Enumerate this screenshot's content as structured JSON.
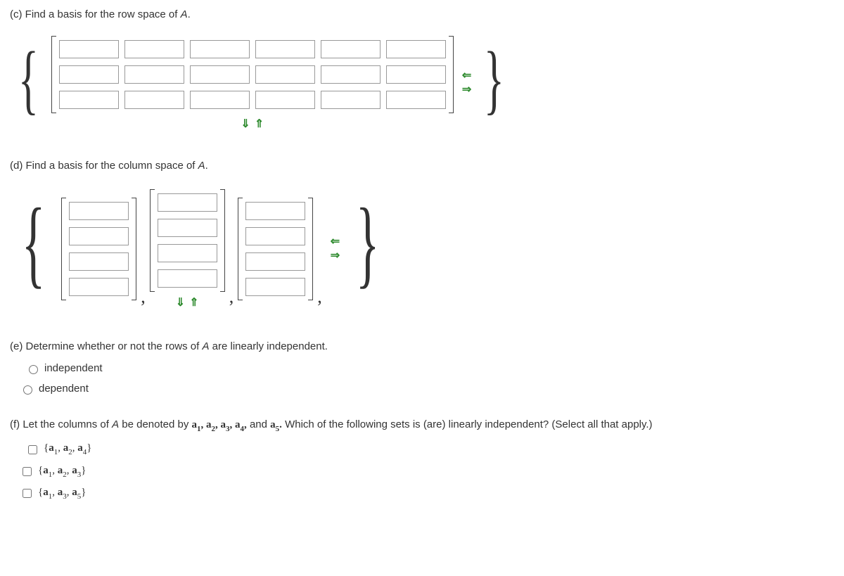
{
  "partC": {
    "label": "(c)",
    "prompt_pre": " Find a basis for the row space of ",
    "matrix_var": "A",
    "prompt_post": "."
  },
  "partD": {
    "label": "(d)",
    "prompt_pre": " Find a basis for the column space of ",
    "matrix_var": "A",
    "prompt_post": "."
  },
  "partE": {
    "label": "(e)",
    "prompt_pre": " Determine whether or not the rows of ",
    "matrix_var": "A",
    "prompt_post": " are linearly independent.",
    "options": {
      "opt1": "independent",
      "opt2": "dependent"
    }
  },
  "partF": {
    "label": "(f)",
    "prompt_pre": " Let the columns of ",
    "matrix_var": "A",
    "prompt_mid": " be denoted by ",
    "prompt_post": " Which of the following sets is (are) linearly independent? (Select all that apply.)",
    "col_list_plain": "a₁, a₂, a₃, a₄, and a₅.",
    "options": {
      "opt1": "{a₁, a₂, a₄}",
      "opt2": "{a₁, a₂, a₃}",
      "opt3": "{a₁, a₃, a₅}"
    }
  },
  "arrows": {
    "down": "⇓",
    "up": "⇑",
    "left": "⇐",
    "right": "⇒"
  }
}
